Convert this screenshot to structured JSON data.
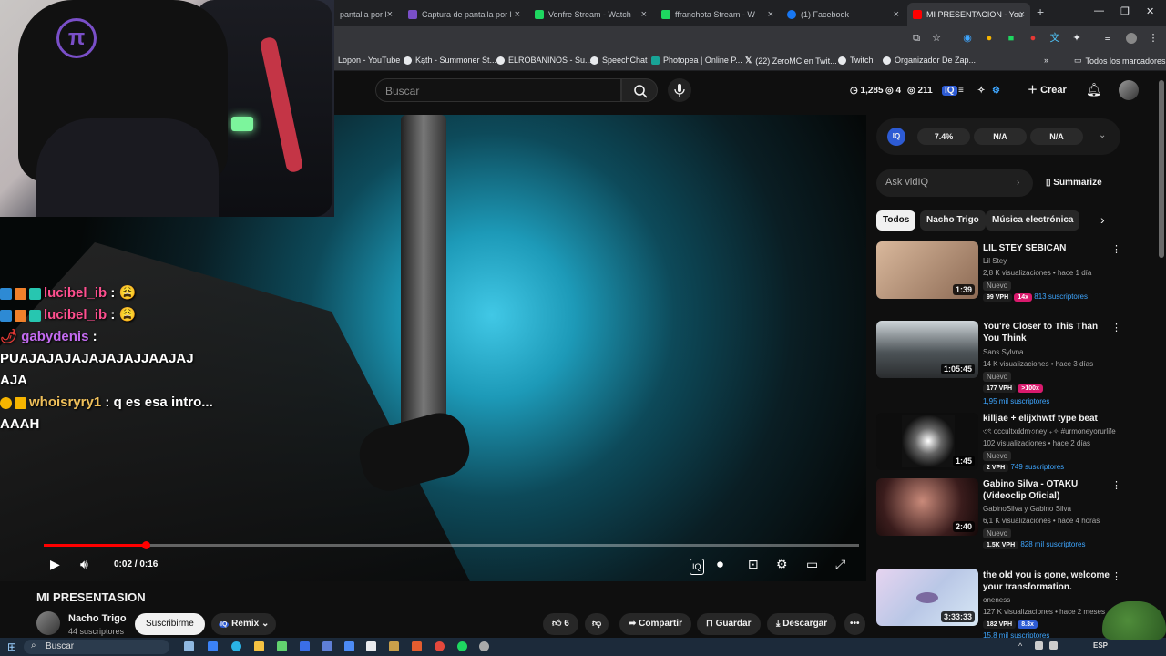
{
  "tabs": [
    {
      "label": "pantalla por l",
      "color": "#7a4fc8"
    },
    {
      "label": "Captura de pantalla por l",
      "color": "#7a4fc8"
    },
    {
      "label": "Vonfre Stream - Watch",
      "color": "#1ed760"
    },
    {
      "label": "ffranchota Stream - W",
      "color": "#1ed760"
    },
    {
      "label": "(1) Facebook",
      "color": "#1877f2"
    },
    {
      "label": "MI PRESENTACION - You",
      "color": "#ff0000"
    }
  ],
  "bookmarks": [
    "Lopon - YouTube",
    "Kạth - Summoner St...",
    "ELROBANIÑOS - Su...",
    "SpeechChat",
    "Photopea | Online P...",
    "(22) ZeroMC en Twit...",
    "Twitch",
    "Organizador De Zap...",
    "Todos los marcadores"
  ],
  "header": {
    "search_placeholder": "Buscar",
    "stat1": "1,285",
    "stat2": "4",
    "stat3": "211",
    "create_label": "Crear"
  },
  "chat": [
    {
      "user": "lucibel_ib",
      "msg": ""
    },
    {
      "user": "lucibel_ib",
      "msg": ""
    },
    {
      "user": "gabydenis",
      "msg": "PUAJAJAJAJAJAJAJJAAJAJ AJA"
    },
    {
      "user": "whoisryry1",
      "msg": "q es esa intro..."
    },
    {
      "user": "",
      "msg": "AAAH"
    }
  ],
  "player": {
    "time": "0:02 / 0:16",
    "progress_fraction": 0.125
  },
  "video": {
    "title": "MI PRESENTASION",
    "channel": "Nacho Trigo",
    "subs": "44 suscriptores",
    "subscribe_label": "Suscribirme",
    "remix_label": "Remix",
    "likes": "6",
    "share_label": "Compartir",
    "save_label": "Guardar",
    "download_label": "Descargar"
  },
  "vidiq": {
    "v1": "7.4%",
    "v2": "N/A",
    "v3": "N/A",
    "ask_placeholder": "Ask vidIQ",
    "summarize_label": "Summarize"
  },
  "chips": [
    "Todos",
    "Nacho Trigo",
    "Música electrónica"
  ],
  "related": [
    {
      "title": "LIL STEY SEBICAN",
      "channel": "Lil Stey",
      "meta": "2,8 K visualizaciones • hace 1 día",
      "tag": "Nuevo",
      "vph": "99 VPH",
      "mult": "14x",
      "subs": "813 suscriptores",
      "duration": "1:39",
      "thumb": "#c9a484"
    },
    {
      "title": "You're Closer to This Than You Think",
      "channel": "Sans Sylvna",
      "meta": "14 K visualizaciones • hace 3 días",
      "tag": "Nuevo",
      "vph": "177 VPH",
      "mult": ">100x",
      "subs": "1,95 mil suscriptores",
      "duration": "1:05:45",
      "thumb": "#6f7a80"
    },
    {
      "title": "killjae + elijxhwtf type beat",
      "channel": "৩ৎ occultxddm৩ney ₊✧ #urmoneyorurlife",
      "meta": "102 visualizaciones • hace 2 días",
      "tag": "Nuevo",
      "vph": "2 VPH",
      "mult": "",
      "subs": "749 suscriptores",
      "duration": "1:45",
      "thumb": "#2b2b2b"
    },
    {
      "title": "Gabino Silva - OTAKU (Videoclip Oficial)",
      "channel": "GabinoSilva y Gabino Silva",
      "meta": "6,1 K visualizaciones • hace 4 horas",
      "tag": "Nuevo",
      "vph": "1.5K VPH",
      "mult": "",
      "subs": "828 mil suscriptores",
      "duration": "2:40",
      "thumb": "#3a1c1c"
    },
    {
      "title": "the old you is gone, welcome your transformation.",
      "channel": "oneness",
      "meta": "127 K visualizaciones • hace 2 meses",
      "tag": "",
      "vph": "182 VPH",
      "mult": "8.3x",
      "subs": "15,8 mil suscriptores",
      "duration": "3:33:33",
      "thumb": "#b9c7e6"
    }
  ],
  "taskbar": {
    "search_placeholder": "Buscar",
    "lang": "ESP"
  }
}
